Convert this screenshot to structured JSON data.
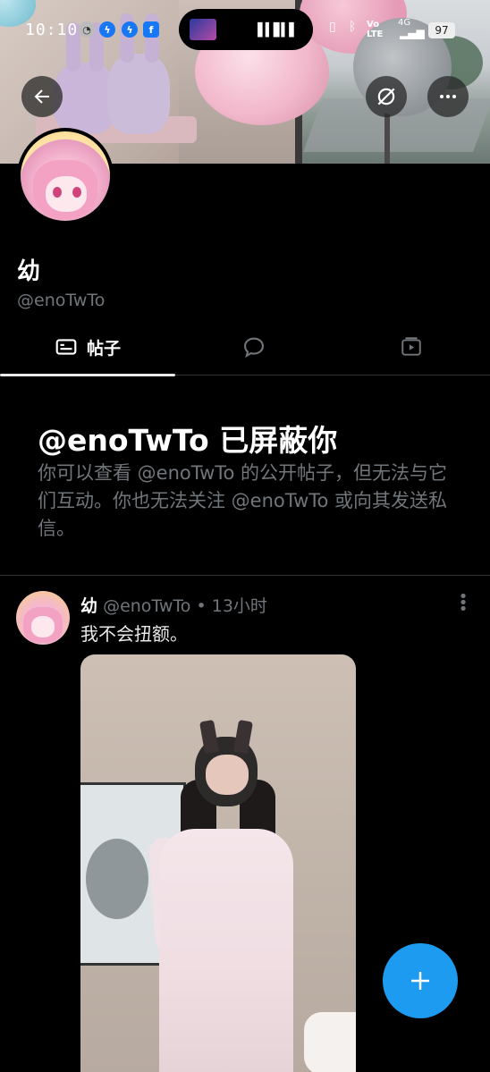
{
  "status_bar": {
    "time": "10:10",
    "network": "Vo LTE",
    "signal": "4G",
    "battery": "97"
  },
  "profile": {
    "name": "幼",
    "handle": "@enoTwTo"
  },
  "tabs": [
    {
      "label": "帖子",
      "icon": "posts-icon",
      "active": true
    },
    {
      "label": "",
      "icon": "replies-icon",
      "active": false
    },
    {
      "label": "",
      "icon": "media-icon",
      "active": false
    }
  ],
  "blocked": {
    "title": "@enoTwTo 已屏蔽你",
    "message": "你可以查看 @enoTwTo 的公开帖子，但无法与它们互动。你也无法关注 @enoTwTo 或向其发送私信。"
  },
  "post": {
    "author": "幼",
    "handle": "@enoTwTo",
    "separator": "•",
    "time": "13小时",
    "text": "我不会扭额。"
  },
  "colors": {
    "accent": "#1d9bf0",
    "background": "#000000",
    "muted_text": "#71767b",
    "divider": "#2f3336"
  }
}
